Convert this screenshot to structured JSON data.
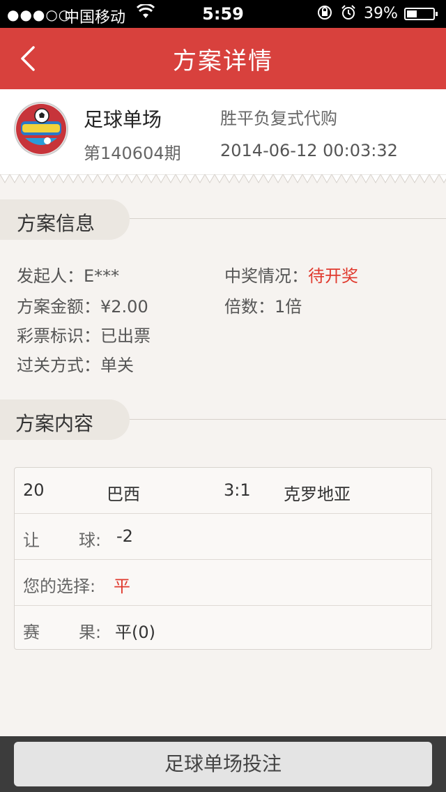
{
  "status_bar": {
    "signal": "●●●○○",
    "carrier": "中国移动",
    "time": "5:59",
    "battery": "39%",
    "battery_level": 0.39
  },
  "nav": {
    "title": "方案详情"
  },
  "header": {
    "lottery_name": "足球单场",
    "issue": "第140604期",
    "play_type": "胜平负复式代购",
    "time": "2014-06-12 00:03:32"
  },
  "plan_info": {
    "section_title": "方案信息",
    "initiator_label": "发起人：",
    "initiator_value": "E***",
    "prize_label": "中奖情况：",
    "prize_value": "待开奖",
    "amount_label": "方案金额：",
    "amount_value": "¥2.00",
    "multiple_label": "倍数：",
    "multiple_value": "1倍",
    "ticket_label": "彩票标识：",
    "ticket_value": "已出票",
    "pass_label": "过关方式：",
    "pass_value": "单关"
  },
  "plan_content": {
    "section_title": "方案内容",
    "match_no": "20",
    "home_team": "巴西",
    "score": "3:1",
    "away_team": "克罗地亚",
    "handicap_label_1": "让",
    "handicap_label_2": "球:",
    "handicap_value": "-2",
    "choice_label": "您的选择:",
    "choice_value": "平",
    "result_label_1": "赛",
    "result_label_2": "果:",
    "result_value": "平(0)"
  },
  "bottom": {
    "button_label": "足球单场投注"
  },
  "colors": {
    "nav_bg": "#d8413d",
    "accent_red": "#e03a2e"
  }
}
